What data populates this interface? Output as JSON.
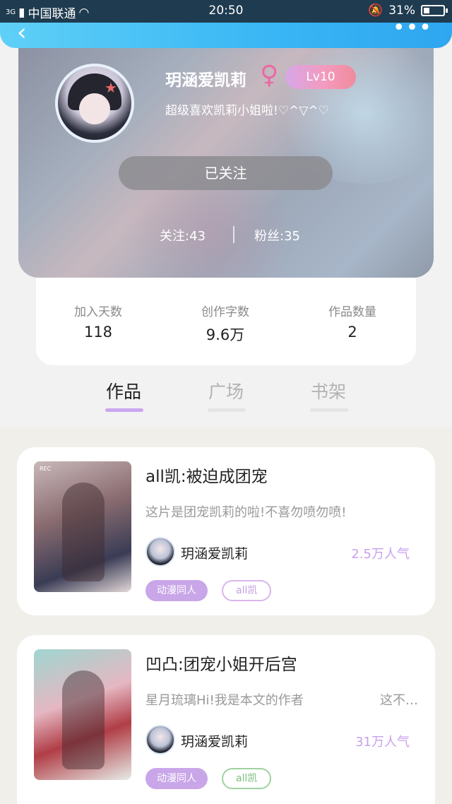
{
  "status_bar": {
    "network": "3G",
    "carrier": "中国联通",
    "time": "20:50",
    "battery": "31%"
  },
  "icons": {
    "back": "chevron-left-icon",
    "more": "more-dots-icon",
    "gender": "female-icon",
    "wifi": "wifi-icon",
    "mute": "bell-off-icon"
  },
  "profile": {
    "name": "玥涵爱凯莉",
    "level": "Lv10",
    "bio": "超级喜欢凯莉小姐啦!♡^▽^♡",
    "follow_button": "已关注",
    "following": "关注:43",
    "fans": "粉丝:35"
  },
  "stats": [
    {
      "label": "加入天数",
      "value": "118"
    },
    {
      "label": "创作字数",
      "value": "9.6万"
    },
    {
      "label": "作品数量",
      "value": "2"
    }
  ],
  "tabs": [
    {
      "label": "作品",
      "active": true
    },
    {
      "label": "广场",
      "active": false
    },
    {
      "label": "书架",
      "active": false
    }
  ],
  "works": [
    {
      "title": "all凯:被迫成团宠",
      "description": "这片是团宠凯莉的啦!不喜勿喷勿喷!",
      "description_more": "",
      "author": "玥涵爱凯莉",
      "popularity": "2.5万人气",
      "genre_tag": "动漫同人",
      "keyword_tag": "all凯",
      "cover_label": "REC"
    },
    {
      "title": "凹凸:团宠小姐开后宫",
      "description": "星月琉璃Hi!我是本文的作者",
      "description_more": "这不…",
      "author": "玥涵爱凯莉",
      "popularity": "31万人气",
      "genre_tag": "动漫同人",
      "keyword_tag": "all凯",
      "cover_label": ""
    }
  ],
  "colors": {
    "header_blue": "#39b6f4",
    "accent_purple": "#c9a6e8",
    "level_pink": "#f39bbf",
    "green_tag": "#7bbf7f"
  }
}
